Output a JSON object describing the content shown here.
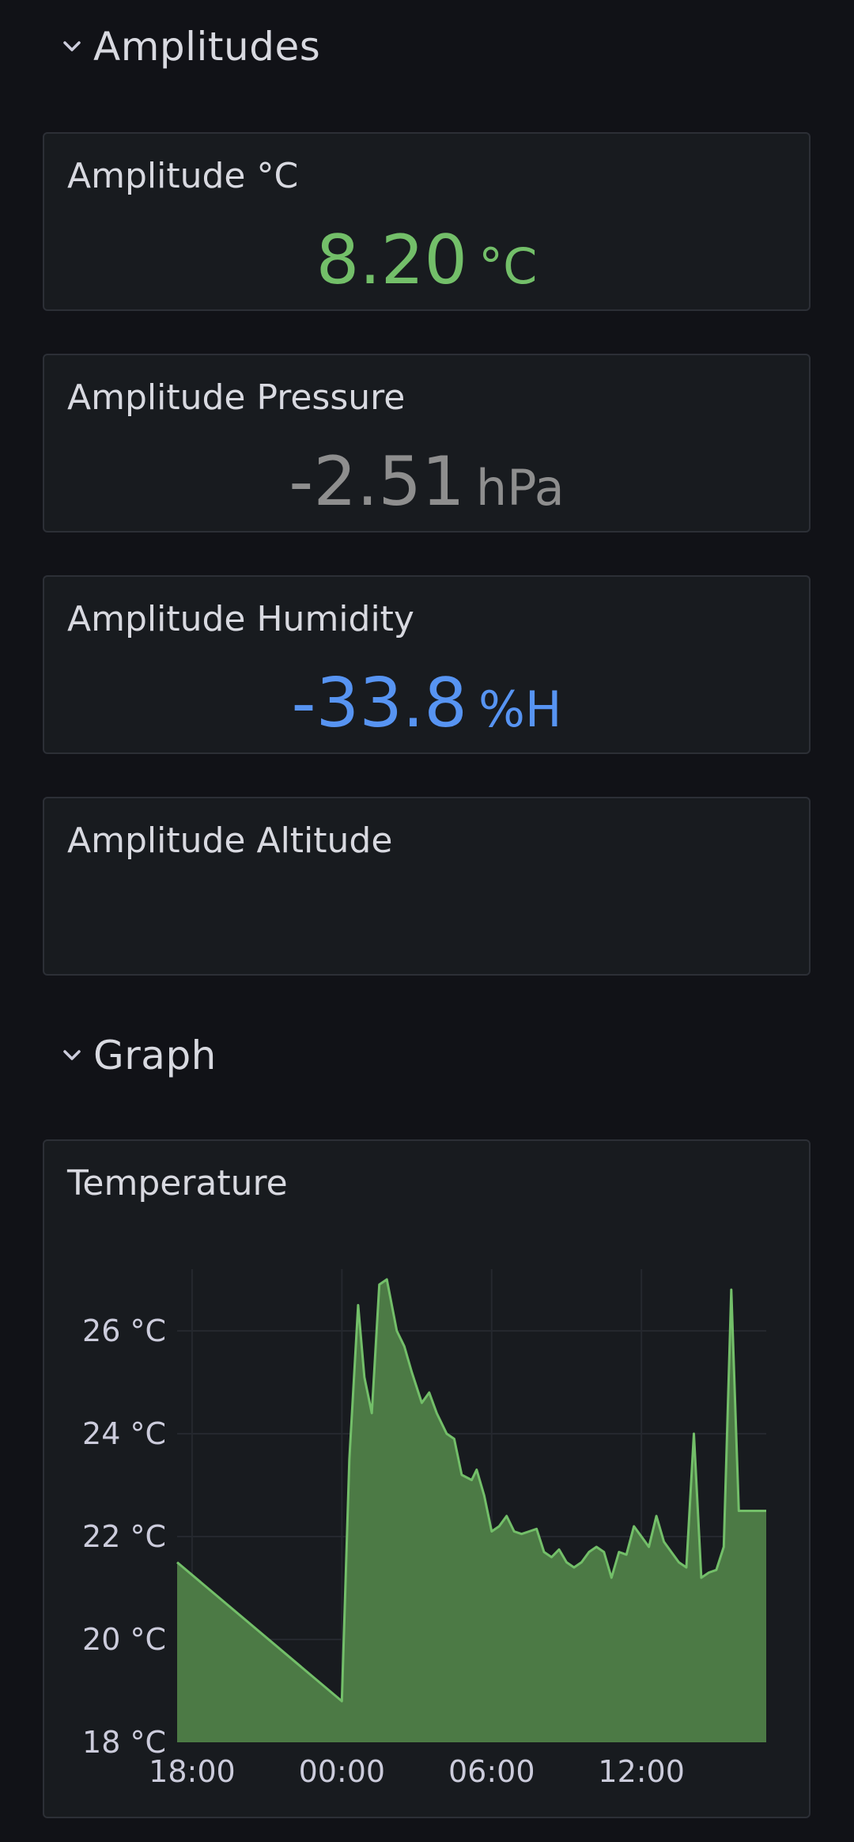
{
  "sections": {
    "amplitudes": {
      "title": "Amplitudes"
    },
    "graph": {
      "title": "Graph"
    }
  },
  "panels": [
    {
      "title": "Amplitude °C",
      "value": "8.20",
      "unit": "°C",
      "color": "#73bf69"
    },
    {
      "title": "Amplitude Pressure",
      "value": "-2.51",
      "unit": "hPa",
      "color": "#8e8e8e"
    },
    {
      "title": "Amplitude Humidity",
      "value": "-33.8",
      "unit": "%H",
      "color": "#5794f2"
    },
    {
      "title": "Amplitude Altitude",
      "value": "",
      "unit": "",
      "color": "#ccccdc"
    }
  ],
  "chart_panel": {
    "title": "Temperature"
  },
  "chart_data": {
    "type": "area",
    "title": "Temperature",
    "xlabel": "",
    "ylabel": "",
    "ylim": [
      18,
      27.2
    ],
    "y_ticks": [
      "26 °C",
      "24 °C",
      "22 °C",
      "20 °C",
      "18 °C"
    ],
    "y_tick_values": [
      26,
      24,
      22,
      20,
      18
    ],
    "x_ticks": [
      "18:00",
      "00:00",
      "06:00",
      "12:00"
    ],
    "x_tick_hours": [
      18,
      24,
      30,
      36
    ],
    "grid": true,
    "line_color": "#73bf69",
    "fill_color": "#4c7a45",
    "series": [
      {
        "x_hours": [
          17.4,
          24.0,
          24.3,
          24.65,
          24.9,
          25.2,
          25.5,
          25.8,
          26.2,
          26.5,
          26.8,
          27.2,
          27.5,
          27.8,
          28.2,
          28.5,
          28.8,
          29.2,
          29.4,
          29.7,
          30.0,
          30.3,
          30.6,
          30.9,
          31.2,
          31.5,
          31.8,
          32.1,
          32.4,
          32.7,
          33.0,
          33.3,
          33.6,
          33.9,
          34.2,
          34.5,
          34.8,
          35.1,
          35.4,
          35.7,
          36.0,
          36.3,
          36.6,
          36.9,
          37.2,
          37.5,
          37.8,
          38.1,
          38.4,
          38.7,
          39.0,
          39.3,
          39.6,
          39.9,
          40.2,
          40.5,
          40.8,
          41.0
        ],
        "values": [
          21.5,
          18.8,
          23.5,
          26.5,
          25.1,
          24.4,
          26.9,
          27.0,
          26.0,
          25.7,
          25.2,
          24.6,
          24.8,
          24.4,
          24.0,
          23.9,
          23.2,
          23.1,
          23.3,
          22.8,
          22.1,
          22.2,
          22.4,
          22.1,
          22.05,
          22.1,
          22.15,
          21.7,
          21.6,
          21.75,
          21.5,
          21.4,
          21.5,
          21.7,
          21.8,
          21.7,
          21.2,
          21.7,
          21.65,
          22.2,
          22.0,
          21.8,
          22.4,
          21.9,
          21.7,
          21.5,
          21.4,
          24.0,
          21.2,
          21.3,
          21.35,
          21.8,
          26.8,
          22.5,
          22.5,
          22.5,
          22.5,
          22.5
        ]
      }
    ]
  }
}
